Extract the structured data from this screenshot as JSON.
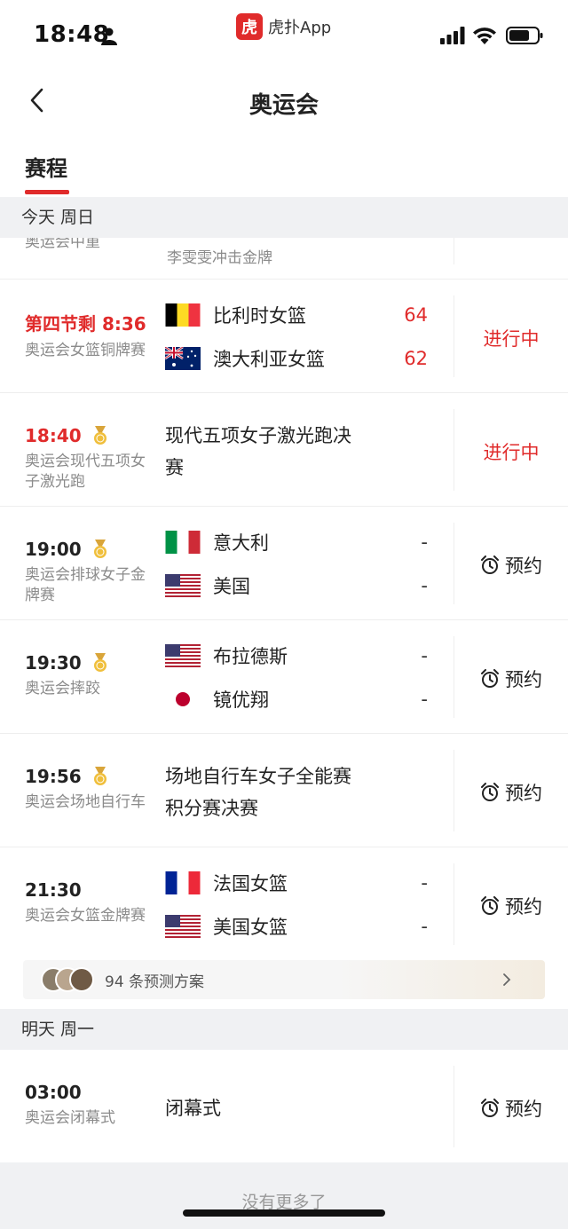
{
  "status_bar": {
    "time": "18:48"
  },
  "app_tag": {
    "logo_text": "虎",
    "name": "虎扑App"
  },
  "nav": {
    "title": "奥运会"
  },
  "tabs": [
    {
      "label": "赛程",
      "active": true
    }
  ],
  "sections": {
    "today": "今天 周日",
    "tomorrow": "明天 周一"
  },
  "partial_row": {
    "desc": "奥运会中重",
    "event": "李雯雯冲击金牌"
  },
  "rows": [
    {
      "time": "第四节剩 8:36",
      "live": true,
      "medal": false,
      "desc": "奥运会女篮铜牌赛",
      "teams": [
        {
          "name": "比利时女篮",
          "flag": "belgium",
          "score": "64"
        },
        {
          "name": "澳大利亚女篮",
          "flag": "australia",
          "score": "62"
        }
      ],
      "status": "进行中"
    },
    {
      "time": "18:40",
      "live": true,
      "medal": true,
      "desc": "奥运会现代五项女子激光跑",
      "event": "现代五项女子激光跑决赛",
      "status": "进行中"
    },
    {
      "time": "19:00",
      "live": false,
      "medal": true,
      "desc": "奥运会排球女子金牌赛",
      "teams": [
        {
          "name": "意大利",
          "flag": "italy",
          "score": "-"
        },
        {
          "name": "美国",
          "flag": "usa",
          "score": "-"
        }
      ],
      "status": "预约"
    },
    {
      "time": "19:30",
      "live": false,
      "medal": true,
      "desc": "奥运会摔跤",
      "teams": [
        {
          "name": "布拉德斯",
          "flag": "usa",
          "score": "-"
        },
        {
          "name": "镜优翔",
          "flag": "japan",
          "score": "-"
        }
      ],
      "status": "预约"
    },
    {
      "time": "19:56",
      "live": false,
      "medal": true,
      "desc": "奥运会场地自行车",
      "event": "场地自行车女子全能赛积分赛决赛",
      "status": "预约"
    },
    {
      "time": "21:30",
      "live": false,
      "medal": false,
      "desc": "奥运会女篮金牌赛",
      "teams": [
        {
          "name": "法国女篮",
          "flag": "france",
          "score": "-"
        },
        {
          "name": "美国女篮",
          "flag": "usa",
          "score": "-"
        }
      ],
      "status": "预约"
    }
  ],
  "prediction": {
    "text": "94 条预测方案"
  },
  "tomorrow_rows": [
    {
      "time": "03:00",
      "desc": "奥运会闭幕式",
      "event": "闭幕式",
      "status": "预约"
    }
  ],
  "footer": {
    "no_more": "没有更多了"
  },
  "colors": {
    "accent": "#e02b2b",
    "section_bg": "#f0f1f3",
    "muted": "#8b8b8b"
  }
}
